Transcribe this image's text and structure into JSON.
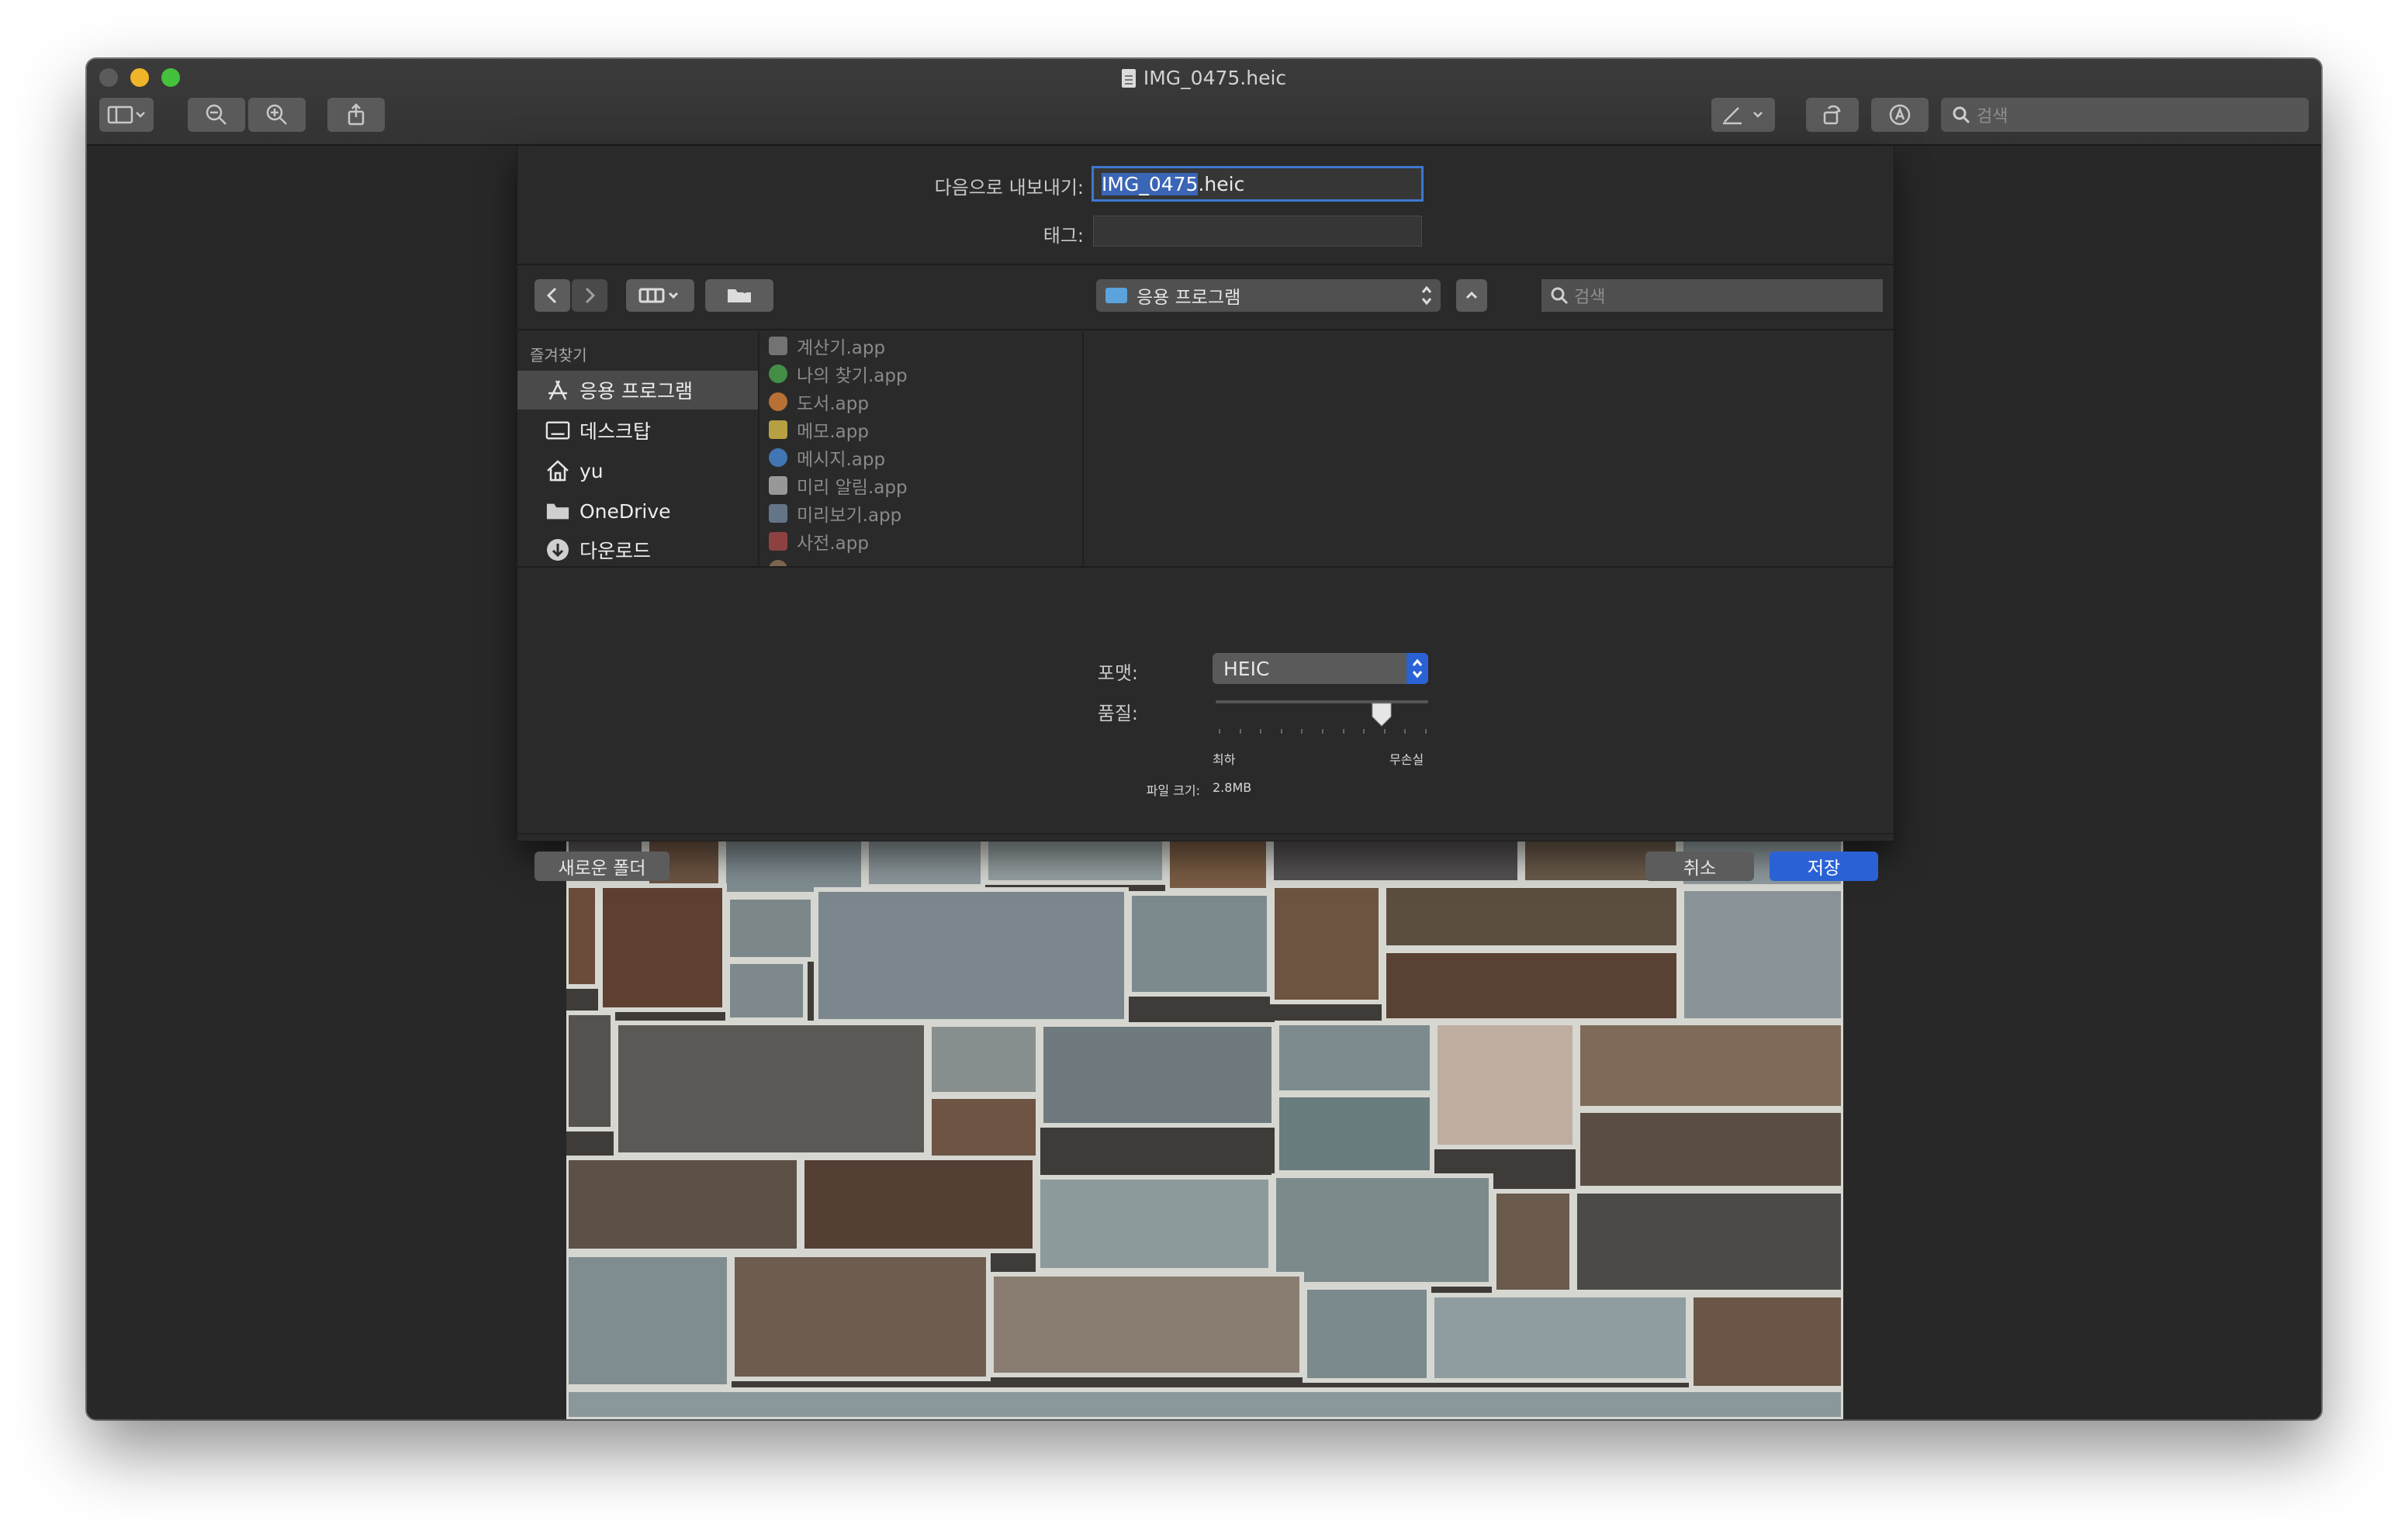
{
  "window": {
    "title": "IMG_0475.heic"
  },
  "toolbar": {
    "search_placeholder": "검색"
  },
  "dialog": {
    "export_as_label": "다음으로 내보내기:",
    "filename_selected": "IMG_0475",
    "filename_ext": ".heic",
    "tags_label": "태그:",
    "tags_value": "",
    "location": "응용 프로그램",
    "search_placeholder": "검색",
    "sidebar": {
      "header": "즐겨찾기",
      "items": [
        {
          "label": "응용 프로그램",
          "icon": "applications-icon",
          "active": true
        },
        {
          "label": "데스크탑",
          "icon": "desktop-icon"
        },
        {
          "label": "yu",
          "icon": "home-icon"
        },
        {
          "label": "OneDrive",
          "icon": "folder-icon"
        },
        {
          "label": "다운로드",
          "icon": "download-icon"
        }
      ]
    },
    "files": [
      {
        "name": "계산기.app",
        "color": "#8c8c8c"
      },
      {
        "name": "나의 찾기.app",
        "color": "#4caf50"
      },
      {
        "name": "도서.app",
        "color": "#e8883a"
      },
      {
        "name": "메모.app",
        "color": "#e6c84a"
      },
      {
        "name": "메시지.app",
        "color": "#4a90e2"
      },
      {
        "name": "미리 알림.app",
        "color": "#bdbdbd"
      },
      {
        "name": "미리보기.app",
        "color": "#7a8fa8"
      },
      {
        "name": "사전.app",
        "color": "#b04a4a"
      }
    ],
    "format_label": "포맷:",
    "format_value": "HEIC",
    "quality_label": "품질:",
    "quality_min": "최하",
    "quality_max": "무손실",
    "quality_level": 0.78,
    "filesize_label": "파일 크기:",
    "filesize_value": "2.8MB",
    "new_folder_button": "새로운 폴더",
    "cancel_button": "취소",
    "save_button": "저장"
  },
  "colors": {
    "accent": "#2a62d6",
    "window_bg": "#282828"
  }
}
